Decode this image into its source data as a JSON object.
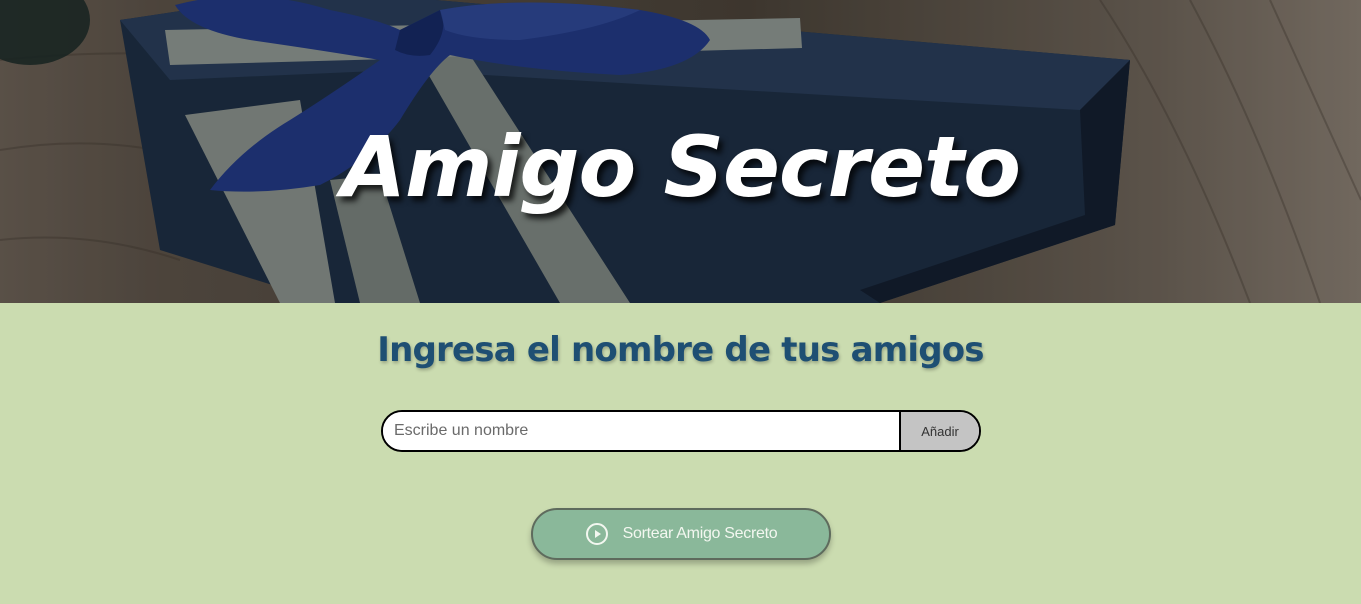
{
  "hero": {
    "title": "Amigo Secreto",
    "image_alt": "Caja de regalo azul con lazo"
  },
  "main": {
    "heading": "Ingresa el nombre de tus amigos",
    "name_input": {
      "placeholder": "Escribe un nombre",
      "value": ""
    },
    "add_button_label": "Añadir",
    "draw_button": {
      "label": "Sortear Amigo Secreto",
      "icon": "play-circle-icon"
    }
  },
  "colors": {
    "background": "#cbdcb0",
    "heading": "#1e4f73",
    "draw_button_bg": "#8ab89a",
    "add_button_bg": "#c4c4c4"
  }
}
